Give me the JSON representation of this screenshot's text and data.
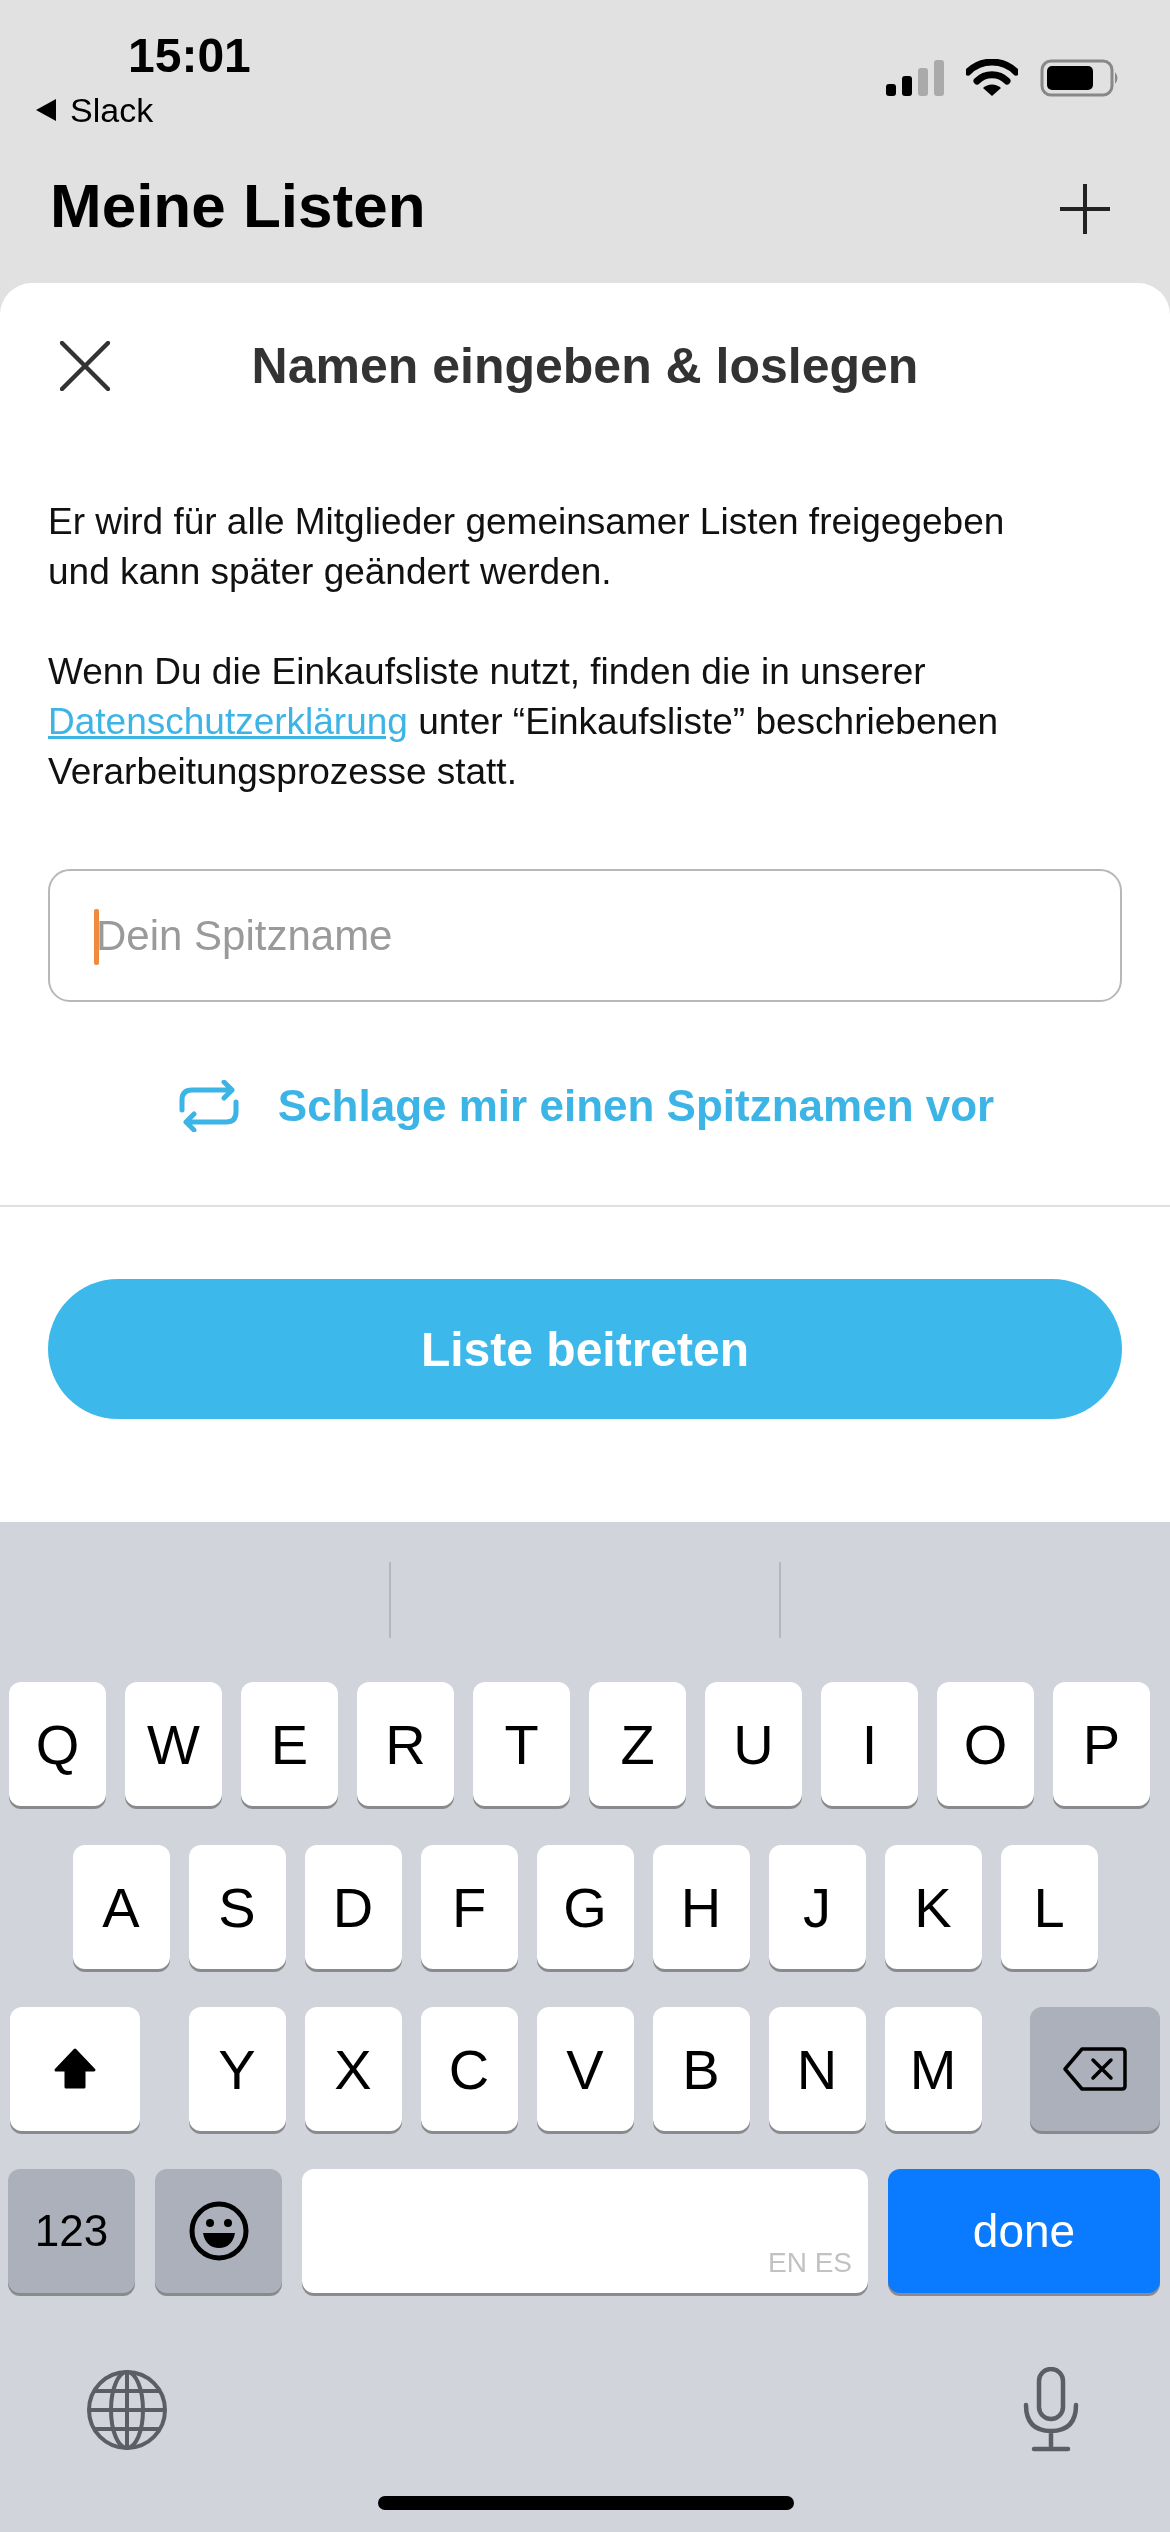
{
  "status_bar": {
    "time": "15:01",
    "back_app": "Slack"
  },
  "header": {
    "title": "Meine Listen"
  },
  "sheet": {
    "title": "Namen eingeben & loslegen",
    "intro": "Er wird für alle Mitglieder gemeinsamer Listen freigegeben und kann später geändert werden.",
    "privacy": {
      "before": "Wenn Du die Einkaufsliste nutzt, finden die in unserer",
      "link": "Datenschutzerklärung",
      "after": "unter “Einkaufsliste” beschriebenen Verarbeitungsprozesse statt."
    },
    "field": {
      "placeholder": "Dein Spitzname",
      "focused": true
    },
    "suggest": "Schlage mir einen Spitznamen vor",
    "button": "Liste beitreten"
  },
  "keyboard": {
    "rows": [
      [
        "Q",
        "W",
        "E",
        "R",
        "T",
        "Z",
        "U",
        "I",
        "O",
        "P"
      ],
      [
        "A",
        "S",
        "D",
        "F",
        "G",
        "H",
        "J",
        "K",
        "L"
      ],
      [
        "Y",
        "X",
        "C",
        "V",
        "B",
        "N",
        "M"
      ]
    ],
    "shift_on": true,
    "bottom": [
      {
        "kind": "numbers",
        "label": "123"
      },
      {
        "kind": "emoji"
      },
      {
        "kind": "space",
        "label": "EN ES"
      },
      {
        "kind": "done",
        "label": "done"
      }
    ]
  }
}
